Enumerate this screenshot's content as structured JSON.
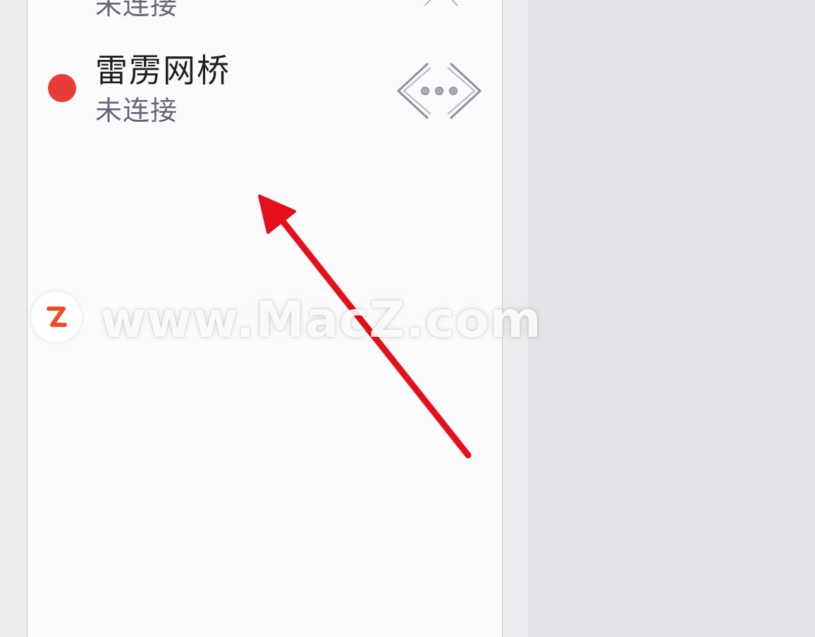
{
  "list": {
    "previous_item": {
      "status": "未连接",
      "icon": "network-device-icon"
    },
    "items": [
      {
        "name": "雷雳网桥",
        "status": "未连接",
        "status_color": "#ea3b3b",
        "icon": "network-device-icon"
      }
    ]
  },
  "overlay": {
    "arrow_color": "#e5101c",
    "watermark_text": "www.MacZ.com",
    "watermark_logo_color": "#f24b1c"
  }
}
